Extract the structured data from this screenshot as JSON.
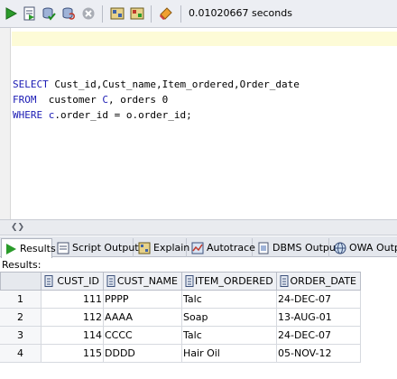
{
  "toolbar": {
    "buttons": [
      {
        "name": "run-statement-button",
        "icon": "play-icon"
      },
      {
        "name": "run-script-button",
        "icon": "script-icon"
      },
      {
        "name": "commit-button",
        "icon": "commit-icon"
      },
      {
        "name": "rollback-button",
        "icon": "rollback-icon"
      },
      {
        "name": "cancel-button",
        "icon": "cancel-icon"
      },
      {
        "name": "sql-tuning-button",
        "icon": "tuning-icon"
      },
      {
        "name": "explain-button",
        "icon": "explain-icon"
      },
      {
        "name": "clear-button",
        "icon": "eraser-icon"
      }
    ],
    "elapsed_time": "0.01020667 seconds"
  },
  "editor": {
    "line1": {
      "kw": "SELECT",
      "rest": " Cust_id,Cust_name,Item_ordered,Order_date"
    },
    "line2": {
      "kw": "FROM",
      "rest_a": "  customer ",
      "alias_c": "C",
      "rest_b": ", orders 0"
    },
    "line3": {
      "kw": "WHERE",
      "alias_c": " c",
      "rest": ".order_id = o.order_id;"
    }
  },
  "tabs": [
    {
      "label": "Results",
      "icon": "results-icon",
      "active": true
    },
    {
      "label": "Script Output",
      "icon": "script-output-icon",
      "active": false
    },
    {
      "label": "Explain",
      "icon": "explain-tab-icon",
      "active": false
    },
    {
      "label": "Autotrace",
      "icon": "autotrace-icon",
      "active": false
    },
    {
      "label": "DBMS Output",
      "icon": "dbms-output-icon",
      "active": false
    },
    {
      "label": "OWA Outp",
      "icon": "owa-output-icon",
      "active": false
    }
  ],
  "results_label": "Results:",
  "grid": {
    "columns": [
      "CUST_ID",
      "CUST_NAME",
      "ITEM_ORDERED",
      "ORDER_DATE"
    ],
    "rows": [
      {
        "n": "1",
        "cust_id": "111",
        "cust_name": "PPPP",
        "item": "Talc",
        "date": "24-DEC-07"
      },
      {
        "n": "2",
        "cust_id": "112",
        "cust_name": "AAAA",
        "item": "Soap",
        "date": "13-AUG-01"
      },
      {
        "n": "3",
        "cust_id": "114",
        "cust_name": "CCCC",
        "item": "Talc",
        "date": "24-DEC-07"
      },
      {
        "n": "4",
        "cust_id": "115",
        "cust_name": "DDDD",
        "item": "Hair Oil",
        "date": "05-NOV-12"
      }
    ]
  },
  "colors": {
    "keyword": "#1b1bb4",
    "toolbar_bg": "#eceef3",
    "current_line": "#fdfbd7"
  }
}
